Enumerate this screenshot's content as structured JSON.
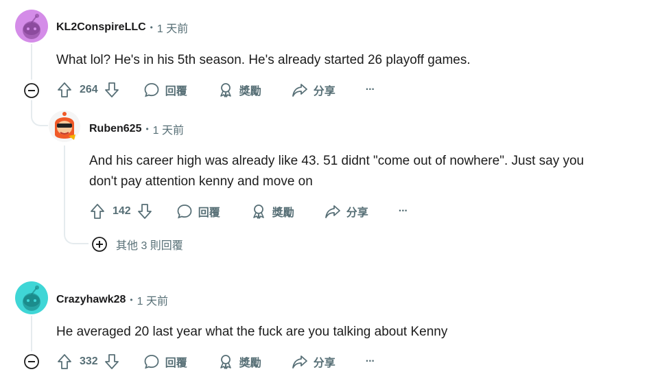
{
  "comments": [
    {
      "username": "KL2ConspireLLC",
      "separator": "•",
      "time": "1 天前",
      "body": "What lol? He's in his 5th season. He's already started 26 playoff games.",
      "votes": "264",
      "avatar_color": "#d48ce8",
      "avatar_icon": "snoo-avatar-icon"
    },
    {
      "username": "Ruben625",
      "separator": "•",
      "time": "1 天前",
      "body_line1": "And his career high was already like 43. 51 didnt \"come out of nowhere\". Just say you",
      "body_line2": "don't pay attention kenny and move on",
      "votes": "142",
      "avatar_color": "#f05a28",
      "avatar_icon": "custom-avatar-icon"
    },
    {
      "username": "Crazyhawk28",
      "separator": "•",
      "time": "1 天前",
      "body": "He averaged 20 last year what the fuck are you talking about Kenny",
      "votes": "332",
      "avatar_color": "#3fd6d6",
      "avatar_icon": "snoo-avatar-icon"
    }
  ],
  "actions": {
    "reply": "回覆",
    "award": "獎勵",
    "share": "分享",
    "more": "···"
  },
  "more_replies": "其他 3 則回覆",
  "colors": {
    "text": "#1c1c1c",
    "meta": "#576f76",
    "thread_line": "#e5ebee"
  }
}
